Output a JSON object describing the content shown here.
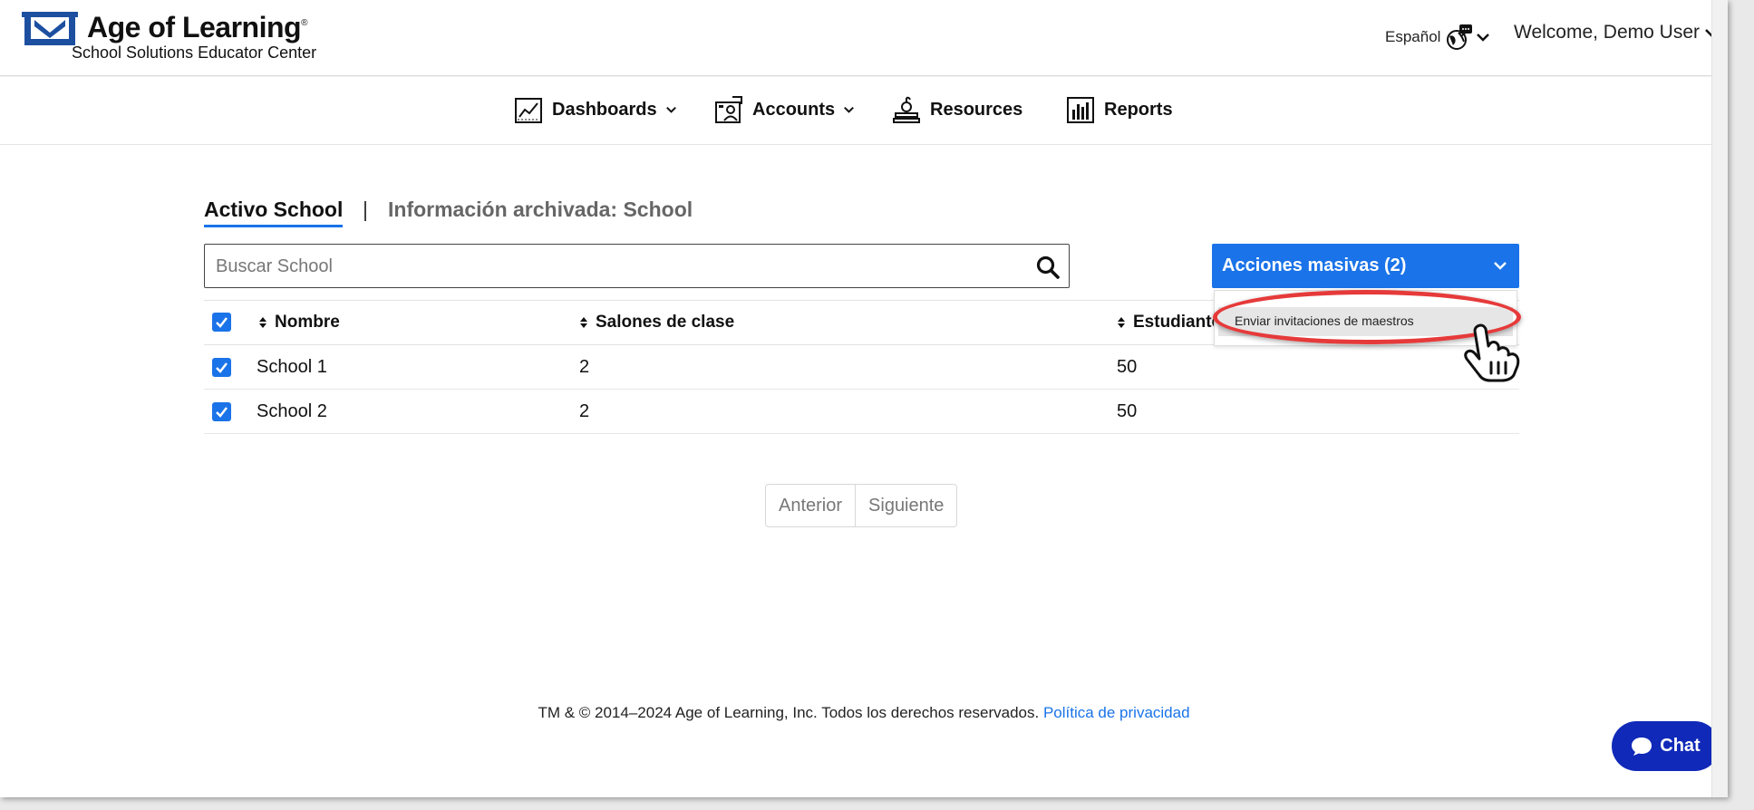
{
  "header": {
    "brand": "Age of Learning",
    "brand_mark": "®",
    "subtitle": "School Solutions Educator Center",
    "language": "Español",
    "welcome": "Welcome, Demo User"
  },
  "nav": {
    "items": [
      {
        "label": "Dashboards",
        "icon": "chart-icon",
        "has_dropdown": true
      },
      {
        "label": "Accounts",
        "icon": "accounts-icon",
        "has_dropdown": true
      },
      {
        "label": "Resources",
        "icon": "resources-icon",
        "has_dropdown": false
      },
      {
        "label": "Reports",
        "icon": "bar-chart-icon",
        "has_dropdown": false
      }
    ]
  },
  "tabs": {
    "active": "Activo School",
    "separator": "|",
    "archived": "Información archivada: School"
  },
  "search": {
    "placeholder": "Buscar School",
    "value": ""
  },
  "bulk_actions": {
    "label": "Acciones masivas (2)",
    "menu": [
      "Enviar invitaciones de maestros"
    ]
  },
  "table": {
    "columns": [
      "Nombre",
      "Salones de clase",
      "Estudiantes"
    ],
    "rows": [
      {
        "name": "School 1",
        "classrooms": "2",
        "students": "50",
        "checked": true
      },
      {
        "name": "School 2",
        "classrooms": "2",
        "students": "50",
        "checked": true
      }
    ]
  },
  "pagination": {
    "prev": "Anterior",
    "next": "Siguiente"
  },
  "footer": {
    "text": "TM & © 2014–2024 Age of Learning, Inc. Todos los derechos reservados.",
    "link": "Política de privacidad"
  },
  "chat": {
    "label": "Chat"
  },
  "colors": {
    "accent": "#1a73e8",
    "chat": "#1029b8",
    "highlight": "#e63a3a"
  }
}
